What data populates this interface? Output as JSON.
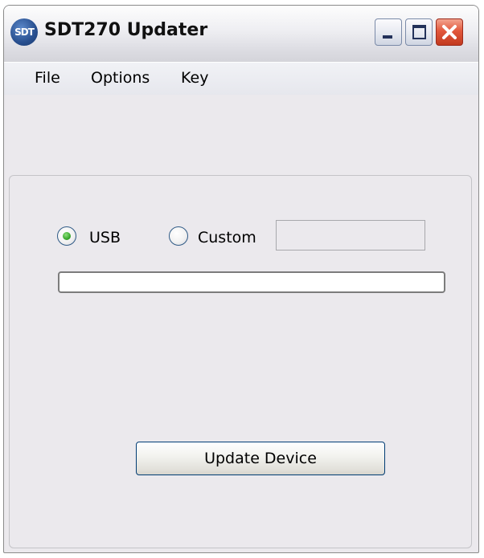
{
  "window": {
    "title": "SDT270 Updater",
    "icon_text": "SDT",
    "icon": "sdt-app-icon"
  },
  "title_buttons": {
    "minimize_icon": "minimize-icon",
    "maximize_icon": "maximize-icon",
    "close_icon": "close-icon",
    "close_color": "#d9472b"
  },
  "menu": {
    "items": [
      {
        "label": "File"
      },
      {
        "label": "Options"
      },
      {
        "label": "Key"
      }
    ]
  },
  "connection": {
    "options": [
      {
        "label": "USB",
        "selected": true
      },
      {
        "label": "Custom",
        "selected": false
      }
    ],
    "custom_value": "",
    "custom_placeholder": "",
    "selected_color": "#38a82c"
  },
  "progress": {
    "value": 0
  },
  "actions": {
    "update_label": "Update Device"
  }
}
